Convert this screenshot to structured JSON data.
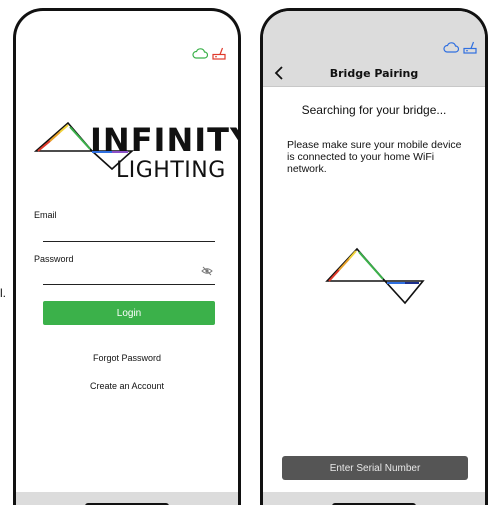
{
  "colors": {
    "login_green": "#3bb14a",
    "cloud_green": "#3bb14a",
    "router_red": "#e0392b",
    "icon_blue": "#2f6fe0",
    "serial_button_gray": "#555555",
    "header_gray": "#dcdcdc"
  },
  "left_screen": {
    "status_icons": [
      "cloud-icon",
      "router-icon"
    ],
    "logo": {
      "word1": "INFINITY",
      "word2": "LIGHTING"
    },
    "email": {
      "label": "Email",
      "value": "",
      "placeholder": ""
    },
    "password": {
      "label": "Password",
      "value": "",
      "placeholder": "",
      "toggle_icon": "eye-slash-icon"
    },
    "login_label": "Login",
    "forgot_password": "Forgot Password",
    "create_account": "Create an Account"
  },
  "right_screen": {
    "status_icons": [
      "cloud-icon",
      "router-icon"
    ],
    "back_icon": "chevron-left-icon",
    "title": "Bridge Pairing",
    "searching": "Searching for your bridge...",
    "instruction": "Please make sure your mobile device is connected to your home WiFi network.",
    "serial_button": "Enter Serial Number"
  },
  "stray_text": "l."
}
